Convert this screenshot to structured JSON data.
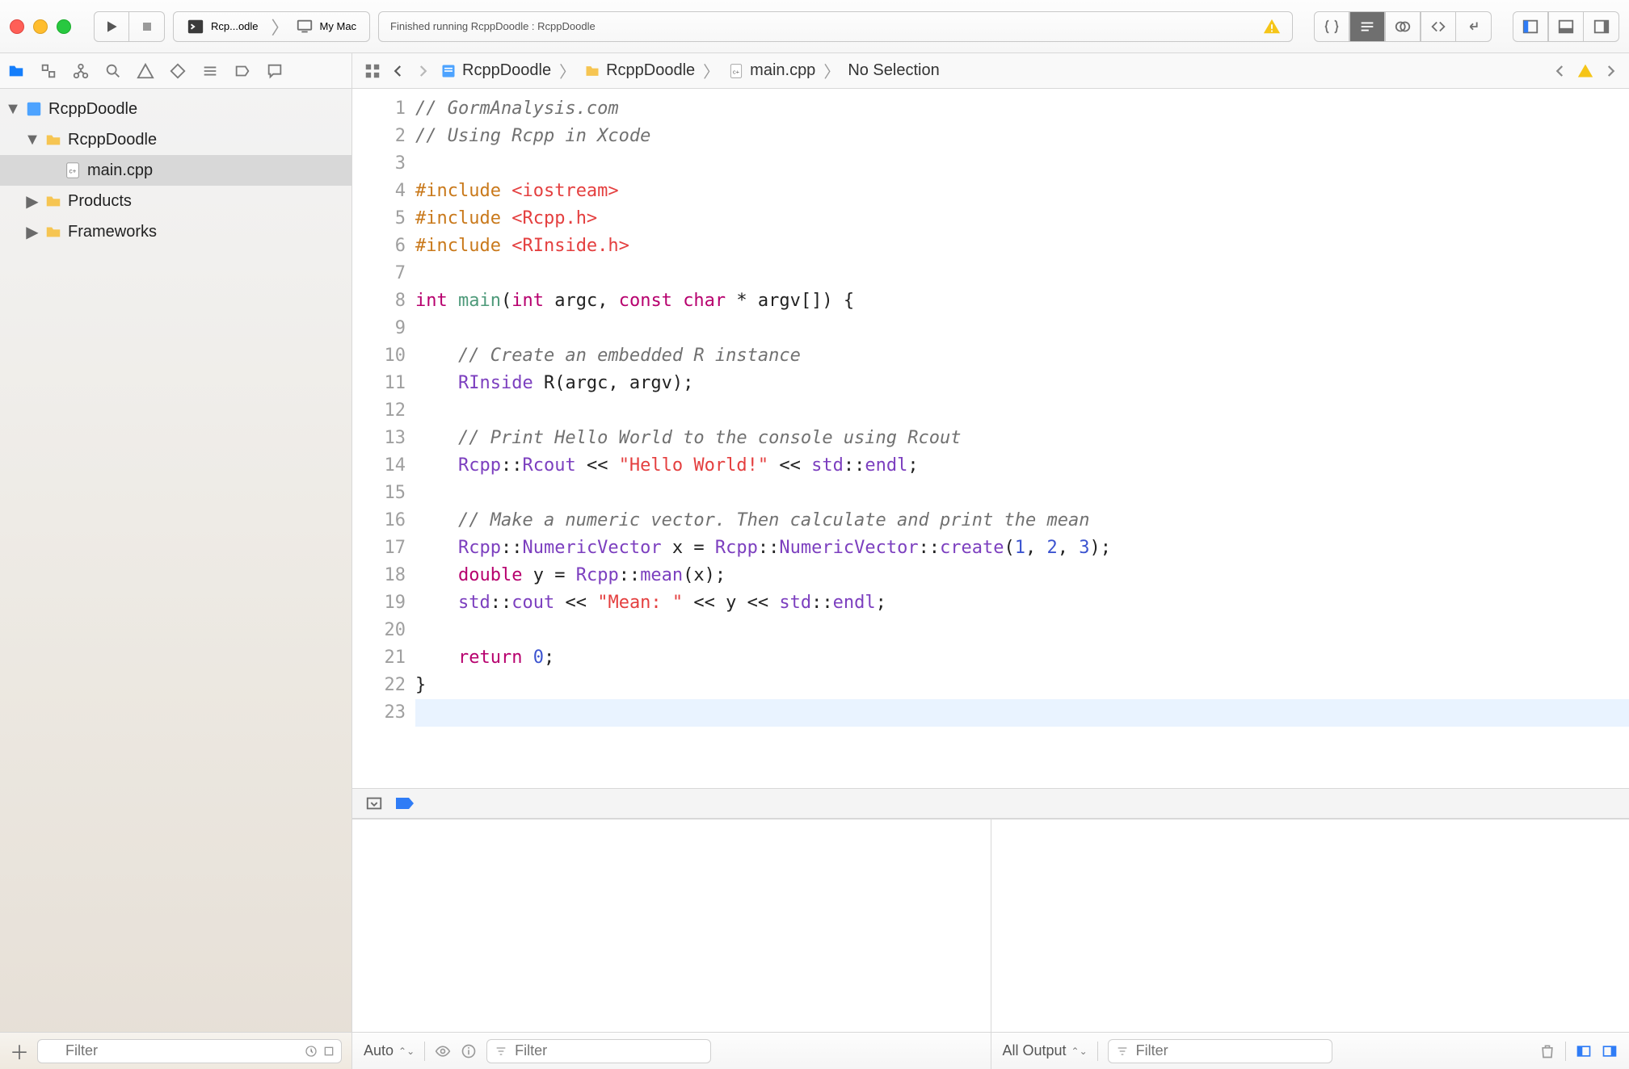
{
  "toolbar": {
    "scheme_name": "Rcp...odle",
    "destination": "My Mac",
    "activity_text": "Finished running RcppDoodle : RcppDoodle",
    "warn_count": ""
  },
  "jumpbar": {
    "project": "RcppDoodle",
    "group": "RcppDoodle",
    "file": "main.cpp",
    "selection": "No Selection"
  },
  "tree": {
    "root": "RcppDoodle",
    "group": "RcppDoodle",
    "file": "main.cpp",
    "products": "Products",
    "frameworks": "Frameworks"
  },
  "sidebar_filter_placeholder": "Filter",
  "editor_lines": [
    "// GormAnalysis.com",
    "// Using Rcpp in Xcode",
    "",
    "#include <iostream>",
    "#include <Rcpp.h>",
    "#include <RInside.h>",
    "",
    "int main(int argc, const char * argv[]) {",
    "",
    "    // Create an embedded R instance",
    "    RInside R(argc, argv);",
    "",
    "    // Print Hello World to the console using Rcout",
    "    Rcpp::Rcout << \"Hello World!\" << std::endl;",
    "",
    "    // Make a numeric vector. Then calculate and print the mean",
    "    Rcpp::NumericVector x = Rcpp::NumericVector::create(1, 2, 3);",
    "    double y = Rcpp::mean(x);",
    "    std::cout << \"Mean: \" << y << std::endl;",
    "",
    "    return 0;",
    "}",
    ""
  ],
  "debug": {
    "vars_mode": "Auto",
    "vars_filter_placeholder": "Filter",
    "console_mode": "All Output",
    "console_filter_placeholder": "Filter"
  }
}
